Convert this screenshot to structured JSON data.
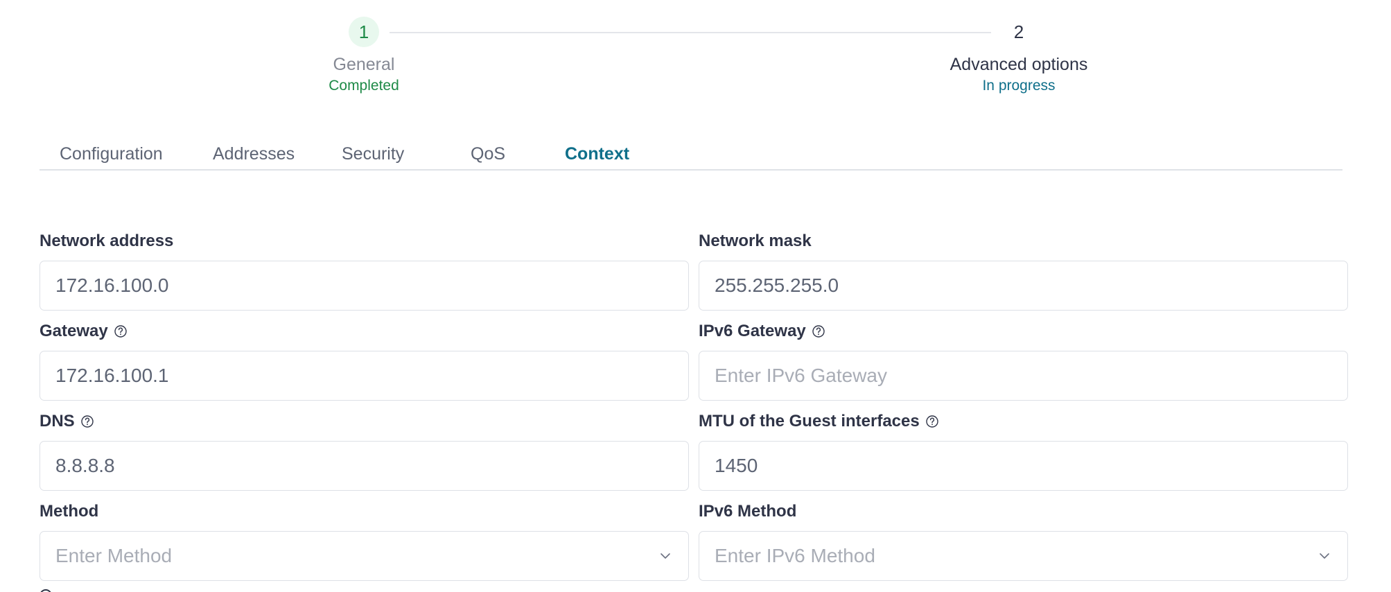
{
  "stepper": {
    "steps": [
      {
        "number": "1",
        "title": "General",
        "status": "Completed"
      },
      {
        "number": "2",
        "title": "Advanced options",
        "status": "In progress"
      }
    ]
  },
  "tabs": [
    {
      "label": "Configuration",
      "active": false
    },
    {
      "label": "Addresses",
      "active": false
    },
    {
      "label": "Security",
      "active": false
    },
    {
      "label": "QoS",
      "active": false
    },
    {
      "label": "Context",
      "active": true
    }
  ],
  "form": {
    "network_address": {
      "label": "Network address",
      "value": "172.16.100.0",
      "placeholder": ""
    },
    "network_mask": {
      "label": "Network mask",
      "value": "255.255.255.0",
      "placeholder": ""
    },
    "gateway": {
      "label": "Gateway",
      "value": "172.16.100.1",
      "placeholder": ""
    },
    "ipv6_gateway": {
      "label": "IPv6 Gateway",
      "value": "",
      "placeholder": "Enter IPv6 Gateway"
    },
    "dns": {
      "label": "DNS",
      "value": "8.8.8.8",
      "placeholder": ""
    },
    "mtu": {
      "label": "MTU of the Guest interfaces",
      "value": "1450",
      "placeholder": ""
    },
    "method": {
      "label": "Method",
      "placeholder": "Enter Method"
    },
    "ipv6_method": {
      "label": "IPv6 Method",
      "placeholder": "Enter IPv6 Method"
    }
  },
  "colors": {
    "accent": "#0f6f8a",
    "success": "#1e8a47",
    "success_bg": "#e8f8ee",
    "text": "#2f3447",
    "muted": "#5d6474",
    "border": "#dde0e6"
  },
  "icons": {
    "help": "help-circle-icon",
    "select": "chevron-down-icon"
  }
}
